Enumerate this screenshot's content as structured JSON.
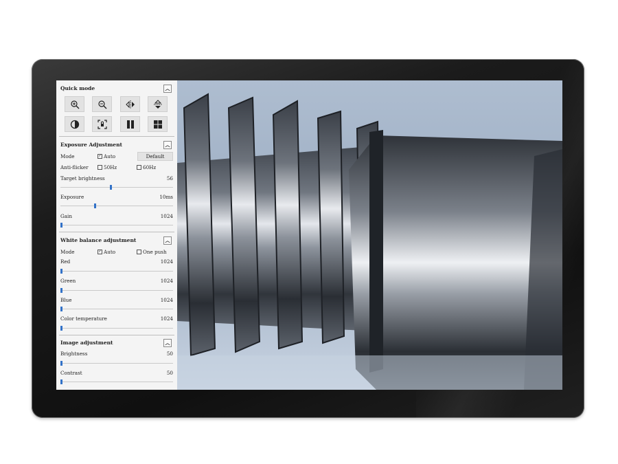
{
  "quick_mode": {
    "title": "Quick mode",
    "tools": [
      {
        "icon": "zoom-in-icon"
      },
      {
        "icon": "zoom-out-icon"
      },
      {
        "icon": "flip-horizontal-icon"
      },
      {
        "icon": "flip-vertical-icon"
      },
      {
        "icon": "contrast-icon"
      },
      {
        "icon": "auto-focus-icon"
      },
      {
        "icon": "pause-icon"
      },
      {
        "icon": "grid-icon"
      }
    ]
  },
  "exposure": {
    "title": "Exposure Adjustment",
    "mode_label": "Mode",
    "auto_label": "Auto",
    "auto_checked": true,
    "default_label": "Default",
    "anti_flicker_label": "Anti-flicker",
    "hz50_label": "50Hz",
    "hz60_label": "60Hz",
    "target_label": "Target brightness",
    "target_value": "56",
    "target_level": 0.44,
    "exposure_label": "Exposure",
    "exposure_value": "10ms",
    "exposure_level": 0.3,
    "gain_label": "Gain",
    "gain_value": "1024",
    "gain_level": 0.0
  },
  "white_balance": {
    "title": "White balance adjustment",
    "mode_label": "Mode",
    "auto_label": "Auto",
    "auto_checked": true,
    "one_push_label": "One push",
    "red_label": "Red",
    "red_value": "1024",
    "green_label": "Green",
    "green_value": "1024",
    "blue_label": "Blue",
    "blue_value": "1024",
    "color_temp_label": "Color temperature",
    "color_temp_value": "1024"
  },
  "image_adjust": {
    "title": "Image adjustment",
    "brightness_label": "Brightness",
    "brightness_value": "50",
    "contrast_label": "Contrast",
    "contrast_value": "50"
  },
  "colors": {
    "accent": "#3272c8",
    "bezel": "#151515",
    "panel": "#f4f4f4"
  }
}
